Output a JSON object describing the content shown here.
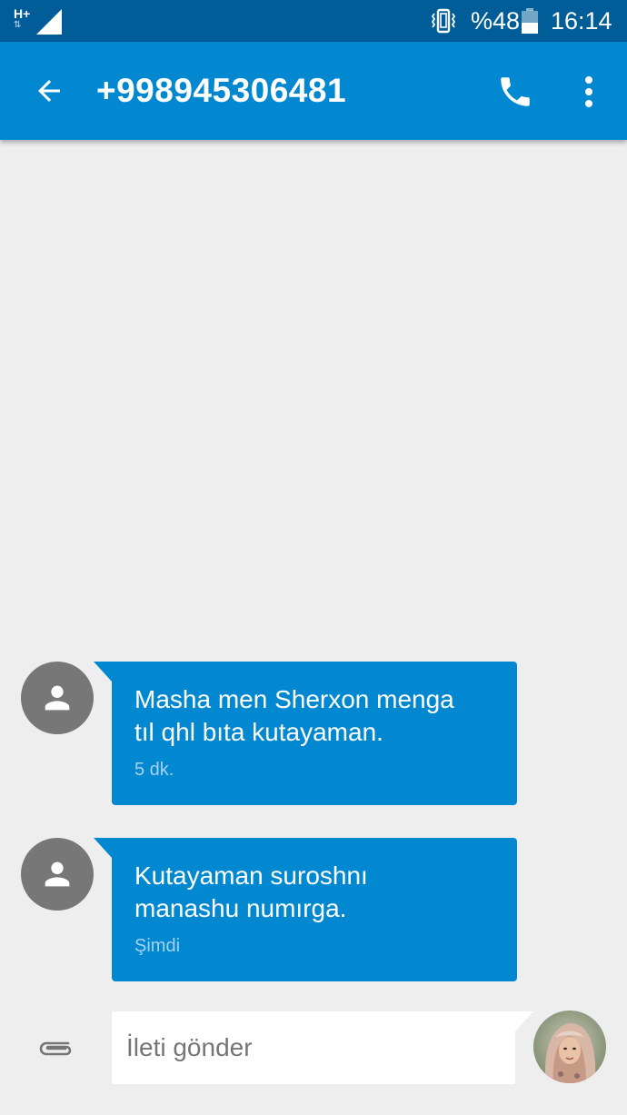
{
  "status_bar": {
    "network_type": "H+",
    "network_arrows": "⇅",
    "battery_percent": "%48",
    "battery_level": 0.48,
    "time": "16:14"
  },
  "toolbar": {
    "title": "+998945306481",
    "icons": {
      "back": "arrow-back-icon",
      "call": "phone-icon",
      "more": "more-vert-icon"
    }
  },
  "messages": [
    {
      "direction": "incoming",
      "text": "Masha men Sherxon menga\ntıl qhl bıta kutayaman.",
      "time": "5 dk."
    },
    {
      "direction": "incoming",
      "text": "Kutayaman suroshnı\nmanashu numırga.",
      "time": "Şimdi"
    }
  ],
  "compose": {
    "placeholder": "İleti gönder",
    "value": ""
  },
  "colors": {
    "status_bar": "#005d97",
    "toolbar": "#0288d1",
    "bubble": "#0288d1",
    "background": "#eeeeee",
    "avatar": "#777777"
  }
}
